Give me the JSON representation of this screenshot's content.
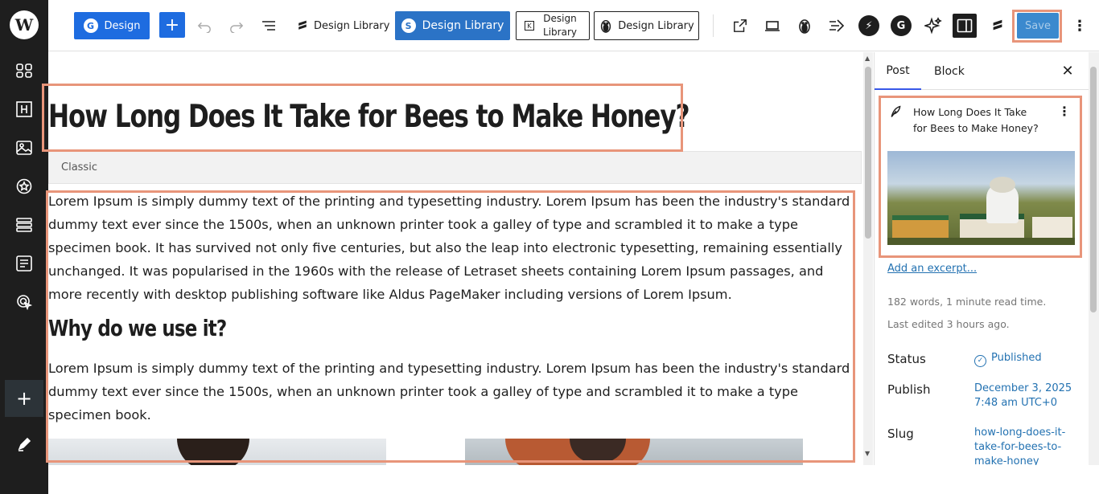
{
  "toolbar": {
    "design_label": "Design",
    "design_icon_glyph": "G",
    "add_glyph": "+",
    "library_labels": [
      "Design Library",
      "Design Library",
      "Design Library",
      "Design Library"
    ],
    "library2_icon_glyph": "S",
    "library3_icon_glyph": "K",
    "save_label": "Save",
    "more_glyph": "⋮",
    "round_glyphs": [
      "⚡",
      "G"
    ]
  },
  "rail": {
    "logo_glyph": "W",
    "add_glyph": "+"
  },
  "post": {
    "title": "How Long Does It Take for Bees to Make Honey?",
    "classic_label": "Classic",
    "paragraph_1": "Lorem Ipsum is simply dummy text of the printing and typesetting industry. Lorem Ipsum has been the industry's standard dummy text ever since the 1500s, when an unknown printer took a galley of type and scrambled it to make a type specimen book. It has survived not only five centuries, but also the leap into electronic typesetting, remaining essentially unchanged. It was popularised in the 1960s with the release of Letraset sheets containing Lorem Ipsum passages, and more recently with desktop publishing software like Aldus PageMaker including versions of Lorem Ipsum.",
    "heading_2": "Why do we use it?",
    "paragraph_2": "Lorem Ipsum is simply dummy text of the printing and typesetting industry. Lorem Ipsum has been the industry's standard dummy text ever since the 1500s, when an unknown printer took a galley of type and scrambled it to make a type specimen book."
  },
  "sidebar": {
    "tabs": [
      "Post",
      "Block"
    ],
    "close_glyph": "✕",
    "post_title": "How Long Does It Take for Bees to Make Honey?",
    "kebab_glyph": "⋮",
    "excerpt_link": "Add an excerpt...",
    "word_count": "182 words, 1 minute read time.",
    "last_edited": "Last edited 3 hours ago.",
    "status_label": "Status",
    "status_value": "Published",
    "status_icon_glyph": "✓",
    "publish_label": "Publish",
    "publish_value": "December 3, 2025 7:48 am UTC+0",
    "slug_label": "Slug",
    "slug_value": "how-long-does-it-take-for-bees-to-make-honey"
  },
  "colors": {
    "accent": "#1e6ce0",
    "library_blue": "#2b73c6",
    "highlight": "#e8957a",
    "link": "#2271b1",
    "rail": "#1e1e1e"
  }
}
